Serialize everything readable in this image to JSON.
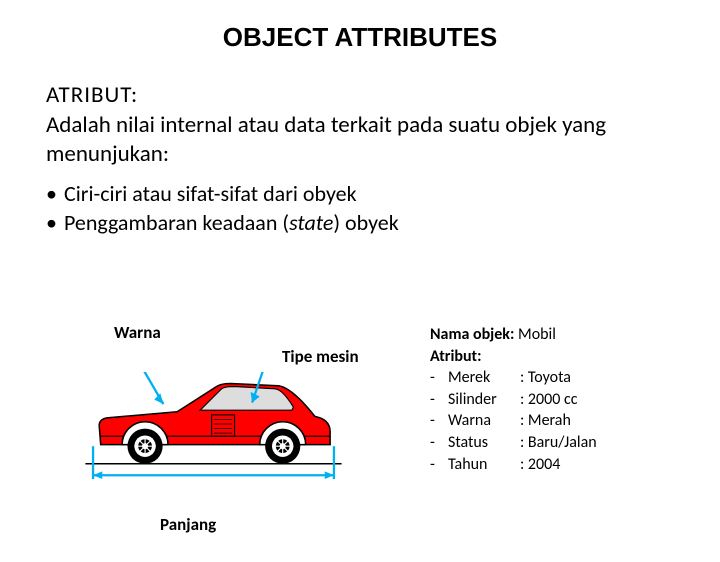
{
  "title": "OBJECT ATTRIBUTES",
  "atribut_label": "ATRIBUT:",
  "definition": "Adalah nilai internal atau data terkait pada suatu objek yang menunjukan:",
  "bullets": {
    "b1": "Ciri-ciri atau sifat-sifat dari obyek",
    "b2_pre": "Penggambaran keadaan (",
    "b2_state": "state",
    "b2_post": ") obyek"
  },
  "diagram": {
    "warna": "Warna",
    "tipe": "Tipe mesin",
    "panjang": "Panjang"
  },
  "attrs": {
    "nama_label": "Nama objek: ",
    "nama_value": "Mobil",
    "atribut_label": "Atribut:",
    "rows": {
      "r0": {
        "key": "Merek",
        "val": ": Toyota"
      },
      "r1": {
        "key": "Silinder",
        "val": ": 2000 cc"
      },
      "r2": {
        "key": "Warna",
        "val": ": Merah"
      },
      "r3": {
        "key": "Status",
        "val": ": Baru/Jalan"
      },
      "r4": {
        "key": "Tahun",
        "val": ": 2004"
      }
    },
    "dash": "-"
  }
}
